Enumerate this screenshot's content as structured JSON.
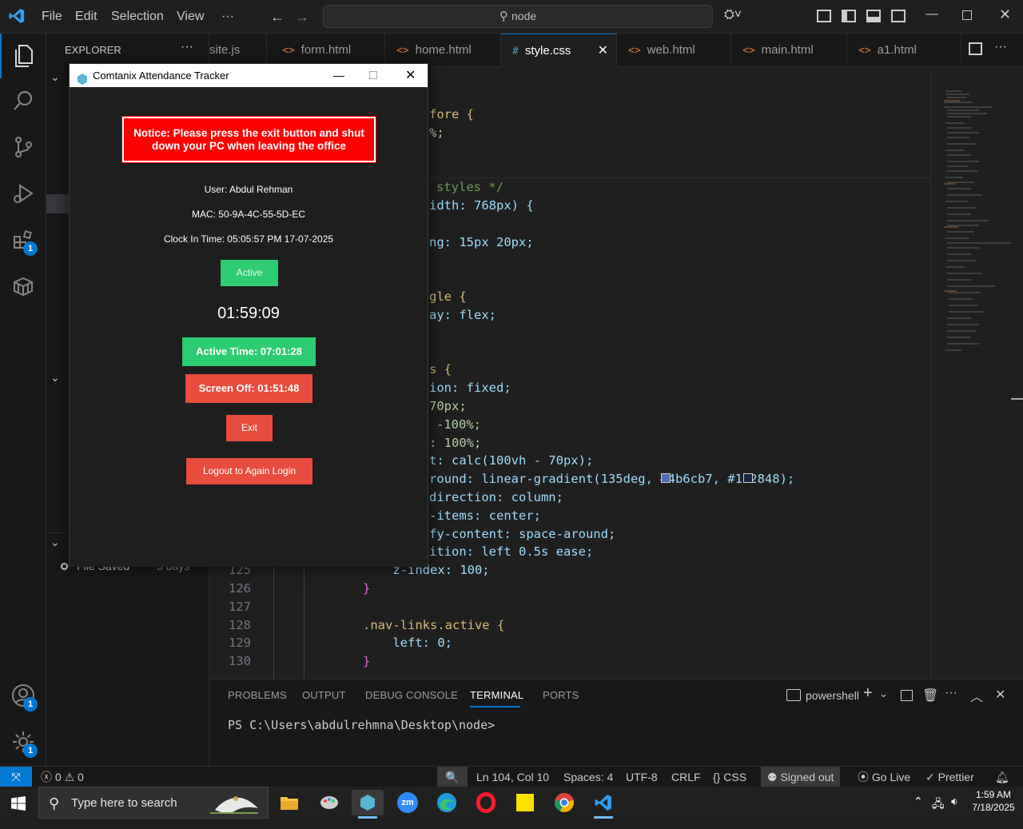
{
  "menubar": {
    "items": [
      "File",
      "Edit",
      "Selection",
      "View",
      "···"
    ],
    "search_text": "node"
  },
  "activity_badges": {
    "extensions": "1",
    "accounts": "1",
    "settings": "1"
  },
  "sidebar": {
    "title": "EXPLORER",
    "timeline_item": "File Saved",
    "timeline_time": "3 days"
  },
  "tabs": [
    {
      "label": "site.js",
      "icon": "js"
    },
    {
      "label": "form.html",
      "icon": "<>"
    },
    {
      "label": "home.html",
      "icon": "<>"
    },
    {
      "label": "style.css",
      "icon": "#"
    },
    {
      "label": "web.html",
      "icon": "<>"
    },
    {
      "label": "main.html",
      "icon": "<>"
    },
    {
      "label": "a1.html",
      "icon": "<>"
    }
  ],
  "code": {
    "visible_fragments": [
      "fore {",
      "%;",
      "styles */",
      "idth: 768px) {",
      "ng: 15px 20px;",
      "gle {",
      "ay: flex;",
      "s {",
      "ion: fixed;",
      "70px;",
      "-100%;",
      ": 100%;",
      "t: calc(100vh - 70px);",
      "round: linear-gradient(135deg, #4b6cb7, #182848);",
      "direction: column;",
      "-items: center;",
      "fy-content: space-around;",
      "ition: left 0.5s ease;"
    ],
    "lines": [
      {
        "num": "125",
        "text": "    z-index: 100;"
      },
      {
        "num": "126",
        "text": "}"
      },
      {
        "num": "127",
        "text": ""
      },
      {
        "num": "128",
        "text": ".nav-links.active {"
      },
      {
        "num": "129",
        "text": "    left: 0;"
      },
      {
        "num": "130",
        "text": "}"
      }
    ]
  },
  "panel": {
    "tabs": [
      "PROBLEMS",
      "OUTPUT",
      "DEBUG CONSOLE",
      "TERMINAL",
      "PORTS"
    ],
    "active_tab": "TERMINAL",
    "shell": "powershell",
    "prompt": "PS C:\\Users\\abdulrehmna\\Desktop\\node>"
  },
  "statusbar": {
    "errors": "0",
    "warnings": "0",
    "position": "Ln 104, Col 10",
    "spaces": "Spaces: 4",
    "encoding": "UTF-8",
    "eol": "CRLF",
    "language": "CSS",
    "account": "Signed out",
    "live": "Go Live",
    "prettier": "Prettier"
  },
  "taskbar": {
    "search_placeholder": "Type here to search",
    "time": "1:59 AM",
    "date": "7/18/2025"
  },
  "tracker": {
    "title": "Comtanix Attendance Tracker",
    "notice": "Notice: Please press the exit button and shut down your PC when leaving the office",
    "user": "User: Abdul Rehman",
    "mac": "MAC: 50-9A-4C-55-5D-EC",
    "clock_in": "Clock In Time: 05:05:57 PM 17-07-2025",
    "status": "Active",
    "timer": "01:59:09",
    "active_time": "Active Time: 07:01:28",
    "screen_off": "Screen Off: 01:51:48",
    "exit_label": "Exit",
    "logout_label": "Logout to Again Login"
  },
  "colors": {
    "accent": "#0078d4",
    "tracker_red": "#e74c3c",
    "tracker_green": "#2ecc71",
    "notice_red": "#ff0000",
    "swatch1": "#4b6cb7",
    "swatch2": "#182848"
  }
}
